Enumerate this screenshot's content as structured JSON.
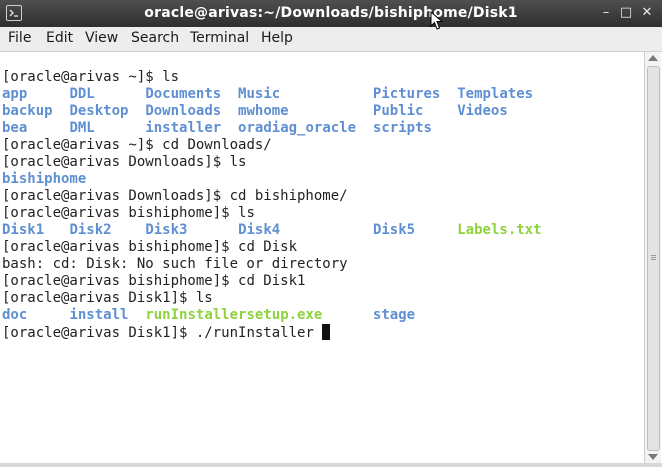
{
  "window": {
    "title": "oracle@arivas:~/Downloads/bishiphome/Disk1",
    "controls": {
      "close": "✕",
      "minimize": "–",
      "maximize": "□"
    }
  },
  "menubar": {
    "items": [
      "File",
      "Edit",
      "View",
      "Search",
      "Terminal",
      "Help"
    ]
  },
  "terminal": {
    "lines": [
      {
        "prompt": "[oracle@arivas ~]$ ",
        "cmd": "ls"
      },
      {
        "cols": [
          [
            "app",
            "blue"
          ],
          [
            "DDL",
            "blue"
          ],
          [
            "Documents",
            "blue"
          ],
          [
            "Music",
            "blue"
          ],
          [
            "Pictures",
            "blue"
          ],
          [
            "Templates",
            "blue"
          ]
        ]
      },
      {
        "cols": [
          [
            "backup",
            "blue"
          ],
          [
            "Desktop",
            "blue"
          ],
          [
            "Downloads",
            "blue"
          ],
          [
            "mwhome",
            "blue"
          ],
          [
            "Public",
            "blue"
          ],
          [
            "Videos",
            "blue"
          ]
        ]
      },
      {
        "cols": [
          [
            "bea",
            "blue"
          ],
          [
            "DML",
            "blue"
          ],
          [
            "installer",
            "blue"
          ],
          [
            "oradiag_oracle",
            "blue"
          ],
          [
            "scripts",
            "blue"
          ]
        ]
      },
      {
        "prompt": "[oracle@arivas ~]$ ",
        "cmd": "cd Downloads/"
      },
      {
        "prompt": "[oracle@arivas Downloads]$ ",
        "cmd": "ls"
      },
      {
        "cols": [
          [
            "bishiphome",
            "blue"
          ]
        ]
      },
      {
        "prompt": "[oracle@arivas Downloads]$ ",
        "cmd": "cd bishiphome/"
      },
      {
        "prompt": "[oracle@arivas bishiphome]$ ",
        "cmd": "ls"
      },
      {
        "cols": [
          [
            "Disk1",
            "blue"
          ],
          [
            "Disk2",
            "blue"
          ],
          [
            "Disk3",
            "blue"
          ],
          [
            "Disk4",
            "blue"
          ],
          [
            "Disk5",
            "blue"
          ],
          [
            "Labels.txt",
            "green"
          ]
        ]
      },
      {
        "prompt": "[oracle@arivas bishiphome]$ ",
        "cmd": "cd Disk"
      },
      {
        "text": "bash: cd: Disk: No such file or directory"
      },
      {
        "prompt": "[oracle@arivas bishiphome]$ ",
        "cmd": "cd Disk1"
      },
      {
        "prompt": "[oracle@arivas Disk1]$ ",
        "cmd": "ls"
      },
      {
        "cols": [
          [
            "doc",
            "blue"
          ],
          [
            "install",
            "blue"
          ],
          [
            "runInstaller",
            "green"
          ],
          [
            "setup.exe",
            "green"
          ],
          [
            "stage",
            "blue"
          ]
        ]
      },
      {
        "prompt": "[oracle@arivas Disk1]$ ",
        "cmd": "./runInstaller",
        "cursor": true
      }
    ]
  }
}
